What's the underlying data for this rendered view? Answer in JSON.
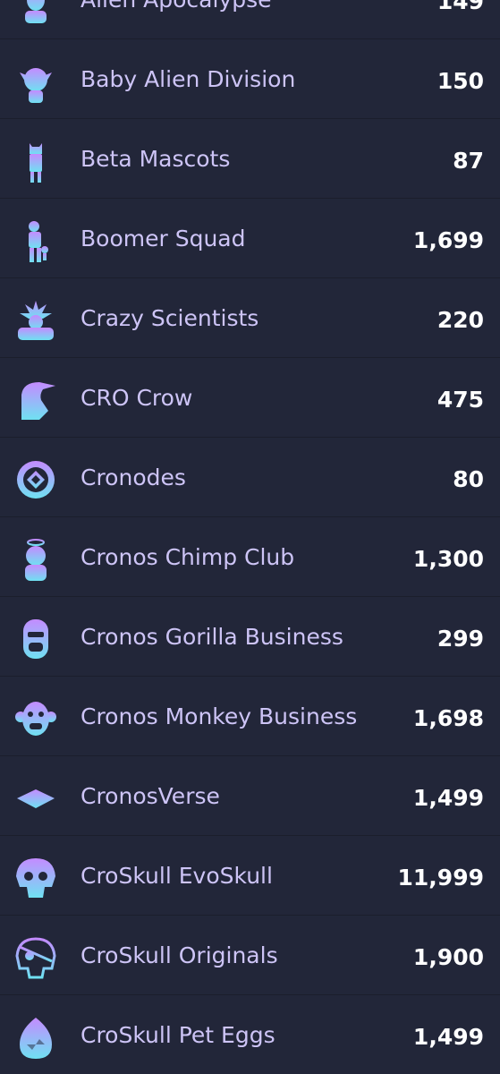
{
  "colors": {
    "background": "#222639",
    "row_divider": "#1b1e2c",
    "name_text": "#cdc4f6",
    "count_text": "#ffffff",
    "icon_gradient_top": "#c48bff",
    "icon_gradient_bottom": "#6fe1f2"
  },
  "collections": [
    {
      "name": "Alien Apocalypse",
      "count": "149",
      "icon": "alien-bust-icon"
    },
    {
      "name": "Baby Alien Division",
      "count": "150",
      "icon": "baby-alien-icon"
    },
    {
      "name": "Beta Mascots",
      "count": "87",
      "icon": "mascot-figure-icon"
    },
    {
      "name": "Boomer Squad",
      "count": "1,699",
      "icon": "boomer-figure-icon"
    },
    {
      "name": "Crazy Scientists",
      "count": "220",
      "icon": "scientist-icon"
    },
    {
      "name": "CRO Crow",
      "count": "475",
      "icon": "crow-icon"
    },
    {
      "name": "Cronodes",
      "count": "80",
      "icon": "cronodes-coin-icon"
    },
    {
      "name": "Cronos Chimp Club",
      "count": "1,300",
      "icon": "chimp-halo-icon"
    },
    {
      "name": "Cronos Gorilla Business",
      "count": "299",
      "icon": "gorilla-icon"
    },
    {
      "name": "Cronos Monkey Business",
      "count": "1,698",
      "icon": "monkey-icon"
    },
    {
      "name": "CronosVerse",
      "count": "1,499",
      "icon": "diamond-icon"
    },
    {
      "name": "CroSkull EvoSkull",
      "count": "11,999",
      "icon": "skull-icon"
    },
    {
      "name": "CroSkull Originals",
      "count": "1,900",
      "icon": "pirate-skull-icon"
    },
    {
      "name": "CroSkull Pet Eggs",
      "count": "1,499",
      "icon": "egg-icon"
    }
  ]
}
